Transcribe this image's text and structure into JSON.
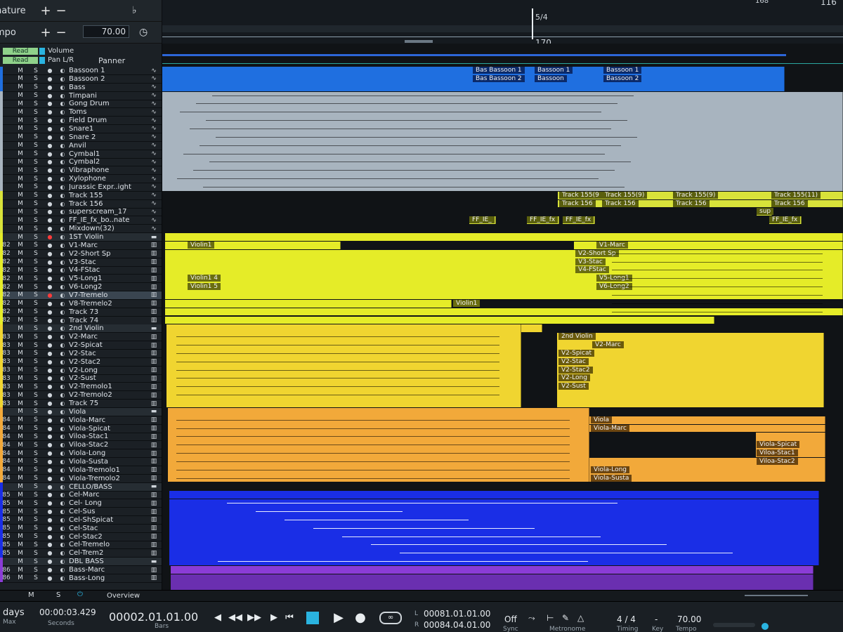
{
  "header": {
    "signature_label": "nature",
    "tempo_label": "mpo",
    "tempo_value": "70.00",
    "plus": "+",
    "minus": "−",
    "time_sig_marker": "5/4",
    "bar_marker": "170",
    "ruler_bars": [
      "168",
      "116"
    ]
  },
  "automation": {
    "read1": "Read",
    "read2": "Read",
    "param1": "Volume",
    "param2": "Pan L/R",
    "panner": "Panner"
  },
  "tracks": [
    {
      "num": "",
      "name": "Bassoon 1",
      "color": "#1f6fe0"
    },
    {
      "num": "",
      "name": "Bassoon 2",
      "color": "#1f6fe0"
    },
    {
      "num": "",
      "name": "Bass",
      "color": "#1f6fe0"
    },
    {
      "num": "",
      "name": "Timpani",
      "color": "#a8b4bf"
    },
    {
      "num": "",
      "name": "Gong Drum",
      "color": "#a8b4bf"
    },
    {
      "num": "",
      "name": "Toms",
      "color": "#a8b4bf"
    },
    {
      "num": "",
      "name": "Field Drum",
      "color": "#a8b4bf"
    },
    {
      "num": "",
      "name": "Snare1",
      "color": "#a8b4bf"
    },
    {
      "num": "",
      "name": "Snare 2",
      "color": "#a8b4bf"
    },
    {
      "num": "",
      "name": "Anvil",
      "color": "#a8b4bf"
    },
    {
      "num": "",
      "name": "Cymbal1",
      "color": "#a8b4bf"
    },
    {
      "num": "",
      "name": "Cymbal2",
      "color": "#a8b4bf"
    },
    {
      "num": "",
      "name": "Vibraphone",
      "color": "#a8b4bf"
    },
    {
      "num": "",
      "name": "Xylophone",
      "color": "#a8b4bf"
    },
    {
      "num": "",
      "name": "Jurassic Expr..ight",
      "color": "#a8b4bf"
    },
    {
      "num": "",
      "name": "Track 155",
      "color": "#d8e23a"
    },
    {
      "num": "",
      "name": "Track 156",
      "color": "#d8e23a"
    },
    {
      "num": "",
      "name": "superscream_17",
      "color": "#d8e23a"
    },
    {
      "num": "",
      "name": "FF_IE_fx_bo..nate",
      "color": "#d8e23a"
    },
    {
      "num": "",
      "name": "Mixdown(32)",
      "color": "#d8e23a"
    },
    {
      "num": "",
      "name": "1ST Violin",
      "color": "#e5ec28",
      "folder": true
    },
    {
      "num": "82",
      "name": "V1-Marc",
      "color": "#e5ec28"
    },
    {
      "num": "82",
      "name": "V2-Short Sp",
      "color": "#e5ec28"
    },
    {
      "num": "82",
      "name": "V3-Stac",
      "color": "#e5ec28"
    },
    {
      "num": "82",
      "name": "V4-FStac",
      "color": "#e5ec28"
    },
    {
      "num": "82",
      "name": "V5-Long1",
      "color": "#e5ec28"
    },
    {
      "num": "82",
      "name": "V6-Long2",
      "color": "#e5ec28"
    },
    {
      "num": "82",
      "name": "V7-Tremelo",
      "color": "#e5ec28",
      "selected": true
    },
    {
      "num": "82",
      "name": "V8-Tremelo2",
      "color": "#e5ec28"
    },
    {
      "num": "82",
      "name": "Track 73",
      "color": "#e5ec28"
    },
    {
      "num": "82",
      "name": "Track 74",
      "color": "#e5ec28"
    },
    {
      "num": "",
      "name": "2nd Violin",
      "color": "#f0d530",
      "folder": true
    },
    {
      "num": "83",
      "name": "V2-Marc",
      "color": "#f0d530"
    },
    {
      "num": "83",
      "name": "V2-Spicat",
      "color": "#f0d530"
    },
    {
      "num": "83",
      "name": "V2-Stac",
      "color": "#f0d530"
    },
    {
      "num": "83",
      "name": "V2-Stac2",
      "color": "#f0d530"
    },
    {
      "num": "83",
      "name": "V2-Long",
      "color": "#f0d530"
    },
    {
      "num": "83",
      "name": "V2-Sust",
      "color": "#f0d530"
    },
    {
      "num": "83",
      "name": "V2-Tremolo1",
      "color": "#f0d530"
    },
    {
      "num": "83",
      "name": "V2-Tremolo2",
      "color": "#f0d530"
    },
    {
      "num": "83",
      "name": "Track 75",
      "color": "#f0d530"
    },
    {
      "num": "",
      "name": "Viola",
      "color": "#f2a93a",
      "folder": true
    },
    {
      "num": "84",
      "name": "Viola-Marc",
      "color": "#f2a93a"
    },
    {
      "num": "84",
      "name": "Viola-Spicat",
      "color": "#f2a93a"
    },
    {
      "num": "84",
      "name": "Viloa-Stac1",
      "color": "#f2a93a"
    },
    {
      "num": "84",
      "name": "Viloa-Stac2",
      "color": "#f2a93a"
    },
    {
      "num": "84",
      "name": "Viola-Long",
      "color": "#f2a93a"
    },
    {
      "num": "84",
      "name": "Viola-Susta",
      "color": "#f2a93a"
    },
    {
      "num": "84",
      "name": "Viola-Tremolo1",
      "color": "#f2a93a"
    },
    {
      "num": "84",
      "name": "Viola-Tremolo2",
      "color": "#f2a93a"
    },
    {
      "num": "",
      "name": "CELLO/BASS",
      "color": "#1a2ee6",
      "folder": true
    },
    {
      "num": "85",
      "name": "Cel-Marc",
      "color": "#1a2ee6"
    },
    {
      "num": "85",
      "name": "Cel- Long",
      "color": "#1a2ee6"
    },
    {
      "num": "85",
      "name": "Cel-Sus",
      "color": "#1a2ee6"
    },
    {
      "num": "85",
      "name": "Cel-ShSpicat",
      "color": "#1a2ee6"
    },
    {
      "num": "85",
      "name": "Cel-Stac",
      "color": "#1a2ee6"
    },
    {
      "num": "85",
      "name": "Cel-Stac2",
      "color": "#1a2ee6"
    },
    {
      "num": "85",
      "name": "Cel-Tremelo",
      "color": "#1a2ee6"
    },
    {
      "num": "85",
      "name": "Cel-Trem2",
      "color": "#1a2ee6"
    },
    {
      "num": "",
      "name": "DBL BASS",
      "color": "#8a3cd6",
      "folder": true
    },
    {
      "num": "86",
      "name": "Bass-Marc",
      "color": "#8a3cd6"
    },
    {
      "num": "86",
      "name": "Bass-Long",
      "color": "#8a3cd6"
    }
  ],
  "track_buttons": {
    "mute": "M",
    "solo": "S"
  },
  "clip_labels": {
    "bassoon_row1": [
      "Bas Bassoon 1",
      "Bassoon 1",
      "Bassoon 1"
    ],
    "bassoon_row2": [
      "Bas Bassoon 2",
      "Bassoon",
      "Bassoon 2"
    ],
    "track155": [
      "Track 155(9",
      "Track 155(9)",
      "Track 155(9)",
      "Track 155(11)"
    ],
    "track156": [
      "Track 156",
      "Track 156",
      "Track 156",
      "Track 156"
    ],
    "sup": "sup",
    "ffie": [
      "FF_IE_",
      "FF_IE_fx",
      "FF_IE_fx",
      "FF_IE_fx"
    ],
    "violin": [
      "Violin1",
      "Violin1 4",
      "Violin1 5",
      "Violin1",
      "V1-Marc",
      "V2-Short Sp",
      "V3-Stac",
      "V4-FStac",
      "V5-Long1",
      "V6-Long2"
    ],
    "violin2": [
      "2nd Violin",
      "V2-Marc",
      "V2-Spicat",
      "V2-Stac",
      "V2-Stac2",
      "V2-Long",
      "V2-Sust"
    ],
    "viola": [
      "Viola",
      "Viola-Marc",
      "Viola-Long",
      "Viola-Susta",
      "Viola-Spicat",
      "Viloa-Stac1",
      "Viloa-Stac2"
    ]
  },
  "bottom": {
    "mute": "M",
    "solo": "S",
    "overview": "Overview"
  },
  "transport": {
    "days": "days",
    "max": "Max",
    "seconds_value": "00:00:03.429",
    "seconds_label": "Seconds",
    "bars_value": "00002.01.01.00",
    "bars_label": "Bars",
    "loop_l_label": "L",
    "loop_r_label": "R",
    "loop_l": "00081.01.01.00",
    "loop_r": "00084.04.01.00",
    "sync_value": "Off",
    "sync_label": "Sync",
    "metronome_label": "Metronome",
    "timing_value": "4 / 4",
    "timing_label": "Timing",
    "key_value": "-",
    "key_label": "Key",
    "tempo_value": "70.00",
    "tempo_label": "Tempo"
  },
  "colors": {
    "blue": "#1f6fe0",
    "grey": "#a8b4bf",
    "lime": "#d8e23a",
    "yellow": "#e5ec28",
    "gold": "#f0d530",
    "orange": "#f2a93a",
    "cello": "#1a2ee6",
    "bass": "#8a3cd6",
    "accent_cyan": "#2ab3e0"
  }
}
